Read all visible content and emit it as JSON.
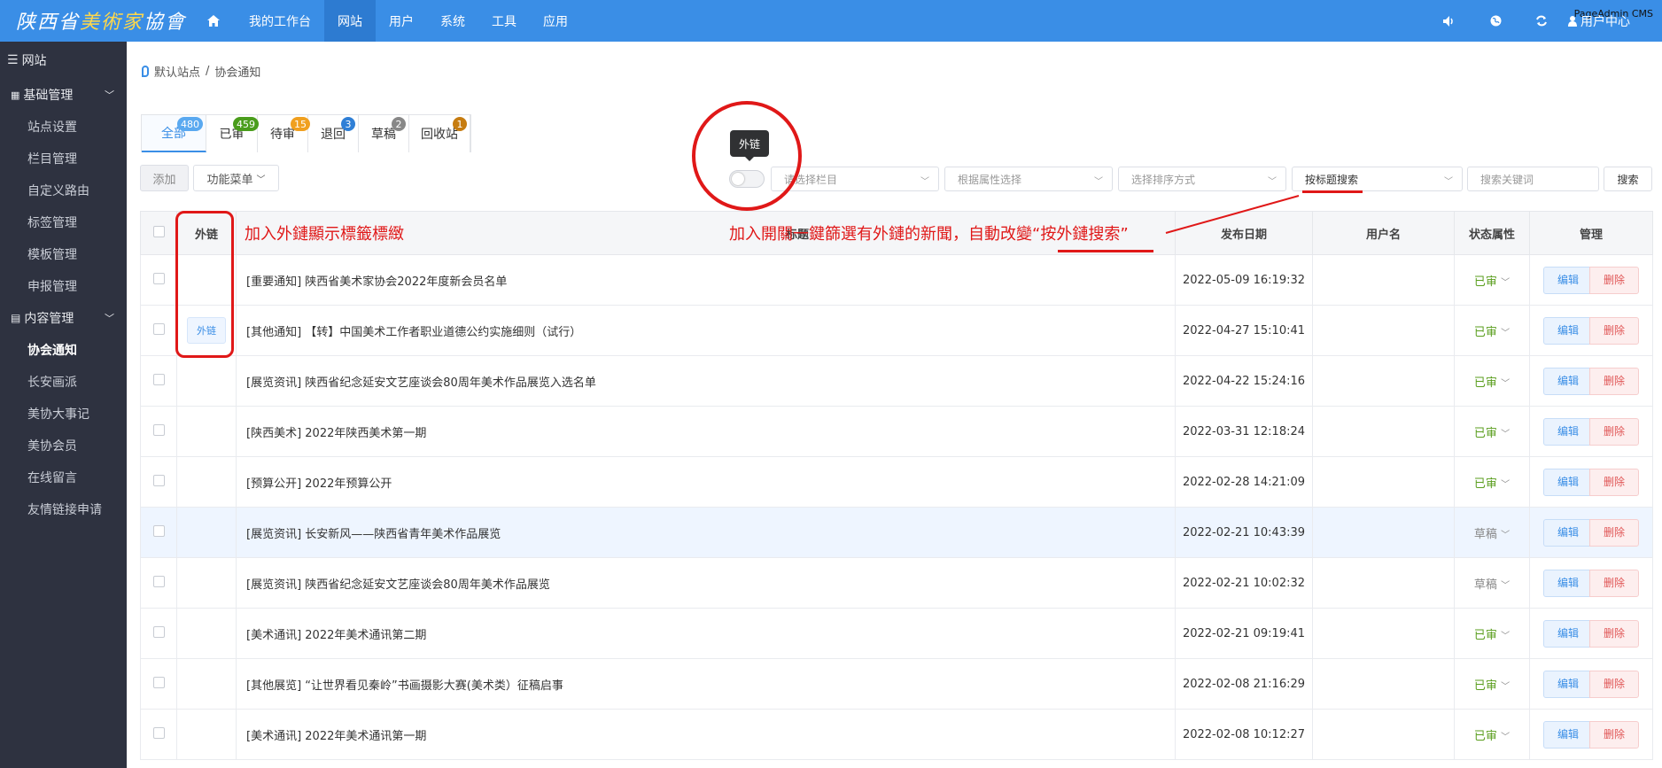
{
  "header": {
    "logo_main": "陕西省",
    "logo_highlight": "美術家",
    "logo_tail": "協會",
    "nav": [
      "我的工作台",
      "网站",
      "用户",
      "系统",
      "工具",
      "应用"
    ],
    "active_nav": "网站",
    "brand_tag": "PageAdmin CMS",
    "user_label": "用户中心",
    "icons": [
      "home-icon",
      "speaker-icon",
      "globe-icon",
      "refresh-icon",
      "user-icon"
    ]
  },
  "sidebar": {
    "title": "网站",
    "groups": [
      {
        "label": "基础管理",
        "items": [
          "站点设置",
          "栏目管理",
          "自定义路由",
          "标签管理",
          "模板管理",
          "申报管理"
        ]
      },
      {
        "label": "内容管理",
        "items": [
          "协会通知",
          "长安画派",
          "美协大事记",
          "美协会员",
          "在线留言",
          "友情链接申请"
        ]
      }
    ],
    "active_item": "协会通知"
  },
  "breadcrumb": {
    "site": "默认站点",
    "separator": "/",
    "page": "协会通知"
  },
  "tabs": [
    {
      "label": "全部",
      "count": "480",
      "color": "#5aa9f0"
    },
    {
      "label": "已审",
      "count": "459",
      "color": "#4a9d1c"
    },
    {
      "label": "待审",
      "count": "15",
      "color": "#f0a020"
    },
    {
      "label": "退回",
      "count": "3",
      "color": "#2f7fd6"
    },
    {
      "label": "草稿",
      "count": "2",
      "color": "#888888"
    },
    {
      "label": "回收站",
      "count": "1",
      "color": "#c67c10"
    }
  ],
  "toolbar": {
    "add_label": "添加",
    "menu_label": "功能菜单",
    "toggle_tooltip": "外链",
    "column_select_placeholder": "请选择栏目",
    "attr_select_placeholder": "根据属性选择",
    "sort_select_placeholder": "选择排序方式",
    "search_mode_value": "按标题搜索",
    "keyword_placeholder": "搜索关键词",
    "search_label": "搜索"
  },
  "table": {
    "headers": {
      "link": "外链",
      "title": "标题",
      "date": "发布日期",
      "user": "用户名",
      "status": "状态属性",
      "ops": "管理"
    },
    "edit_label": "编辑",
    "delete_label": "删除",
    "rows": [
      {
        "link": "",
        "title": "[重要通知] 陕西省美术家协会2022年度新会员名单",
        "date": "2022-05-09 16:19:32",
        "user": "",
        "status": "已审"
      },
      {
        "link": "外链",
        "title": "[其他通知] 【转】中国美术工作者职业道德公约实施细则（试行）",
        "date": "2022-04-27 15:10:41",
        "user": "",
        "status": "已审"
      },
      {
        "link": "",
        "title": "[展览资讯] 陕西省纪念延安文艺座谈会80周年美术作品展览入选名单",
        "date": "2022-04-22 15:24:16",
        "user": "",
        "status": "已审"
      },
      {
        "link": "",
        "title": "[陕西美术] 2022年陕西美术第一期",
        "date": "2022-03-31 12:18:24",
        "user": "",
        "status": "已审"
      },
      {
        "link": "",
        "title": "[预算公开] 2022年预算公开",
        "date": "2022-02-28 14:21:09",
        "user": "",
        "status": "已审"
      },
      {
        "link": "",
        "title": "[展览资讯] 长安新风——陕西省青年美术作品展览",
        "date": "2022-02-21 10:43:39",
        "user": "",
        "status": "草稿"
      },
      {
        "link": "",
        "title": "[展览资讯] 陕西省纪念延安文艺座谈会80周年美术作品展览",
        "date": "2022-02-21 10:02:32",
        "user": "",
        "status": "草稿"
      },
      {
        "link": "",
        "title": "[美术通讯] 2022年美术通讯第二期",
        "date": "2022-02-21 09:19:41",
        "user": "",
        "status": "已审"
      },
      {
        "link": "",
        "title": "[其他展览] “让世界看见秦岭”书画摄影大赛(美术类）征稿启事",
        "date": "2022-02-08 21:16:29",
        "user": "",
        "status": "已审"
      },
      {
        "link": "",
        "title": "[美术通讯] 2022年美术通讯第一期",
        "date": "2022-02-08 10:12:27",
        "user": "",
        "status": "已审"
      }
    ]
  },
  "annotations": {
    "link_column_note": "加入外鏈顯示標籤標緻",
    "toggle_note_prefix": "加入開關一鍵篩選有外鏈的新聞，自動改變",
    "toggle_note_quote": "“按外鏈搜索”"
  }
}
